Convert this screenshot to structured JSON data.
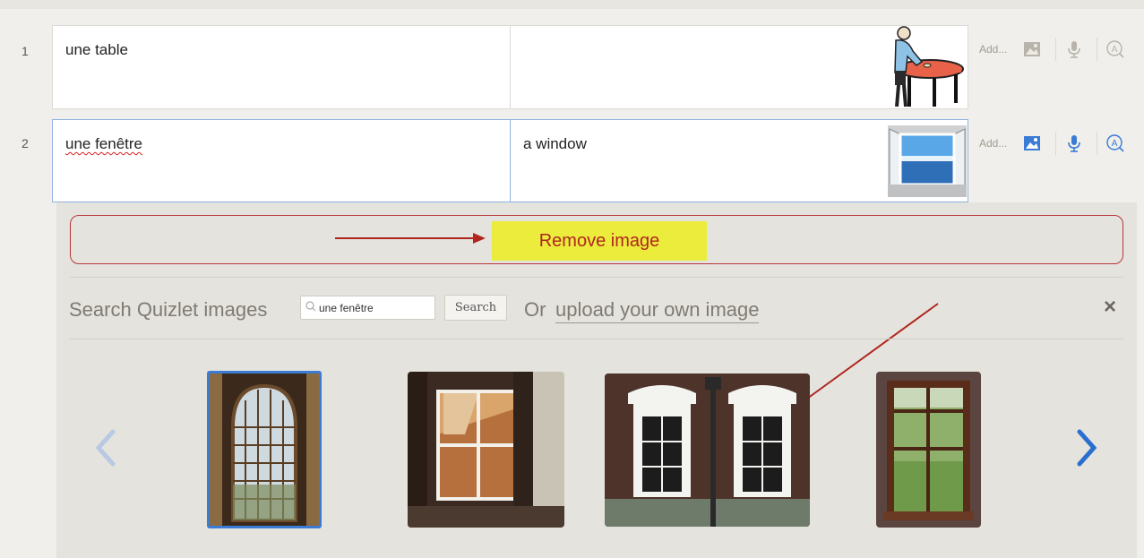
{
  "rows": [
    {
      "number": "1",
      "term": "une table",
      "definition": "",
      "image": "table-person-image",
      "add_label": "Add..."
    },
    {
      "number": "2",
      "term": "une fenêtre",
      "definition": "a window",
      "image": "window-image",
      "add_label": "Add..."
    }
  ],
  "image_panel": {
    "remove_label": "Remove image",
    "search_label": "Search Quizlet images",
    "search_value": "une fenêtre",
    "search_button": "Search",
    "or_text": "Or",
    "upload_link": "upload your own image",
    "close_label": "×",
    "results": [
      {
        "name": "arched-window-thumbnail",
        "selected": true
      },
      {
        "name": "reflection-window-thumbnail",
        "selected": false
      },
      {
        "name": "white-trim-windows-thumbnail",
        "selected": false
      },
      {
        "name": "wooden-window-thumbnail",
        "selected": false
      }
    ]
  },
  "icons": [
    "image-icon",
    "microphone-icon",
    "accessibility-icon",
    "chevron-left-icon",
    "chevron-right-icon",
    "close-icon",
    "search-icon"
  ],
  "colors": {
    "accent": "#3a7bd5",
    "highlight": "#ecec3c",
    "annotation": "#b0261f"
  }
}
